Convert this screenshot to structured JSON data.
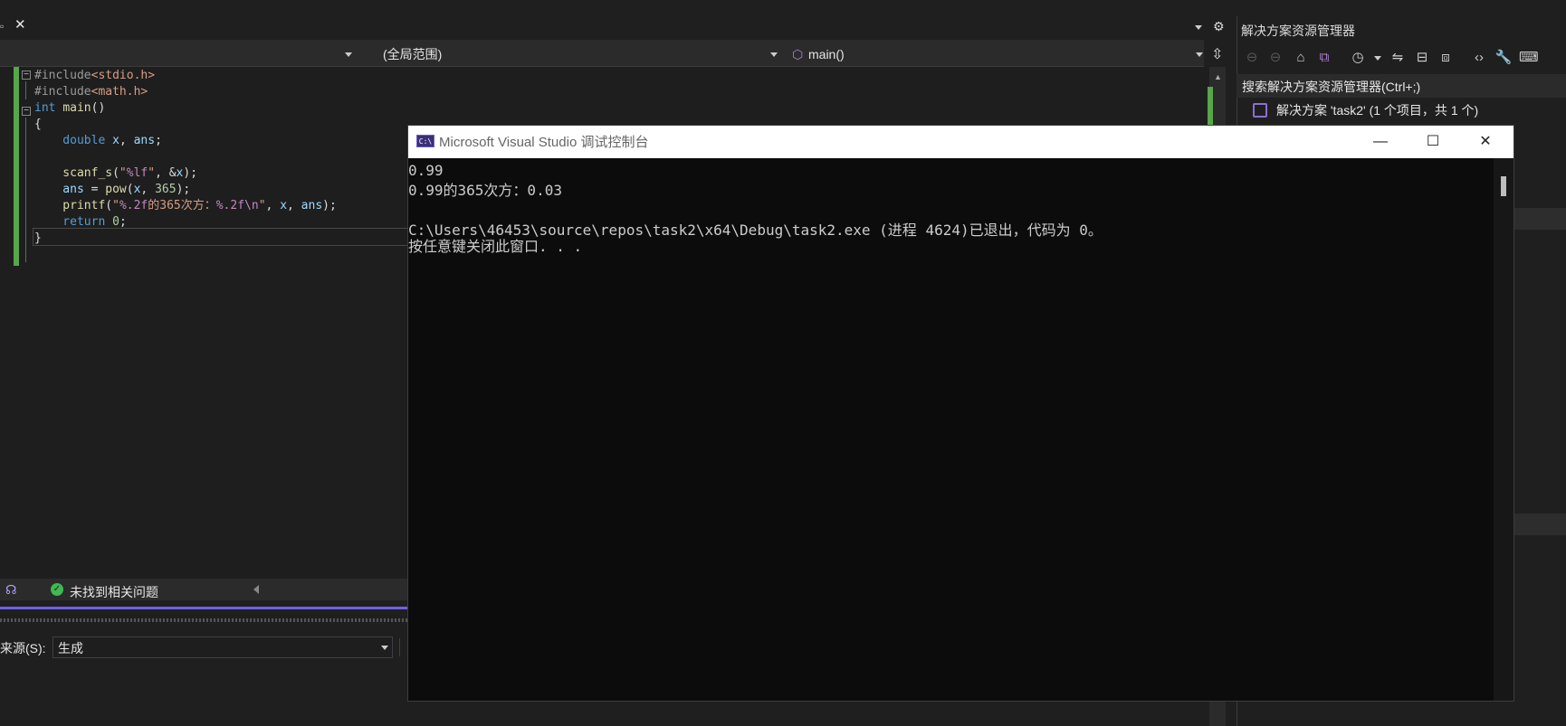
{
  "editor": {
    "scope_combo": "(全局范围)",
    "member_combo": "main()",
    "code": [
      [
        {
          "c": "pp",
          "t": "#include"
        },
        {
          "c": "inc",
          "t": "<stdio.h>"
        }
      ],
      [
        {
          "c": "pp",
          "t": "#include"
        },
        {
          "c": "inc",
          "t": "<math.h>"
        }
      ],
      [
        {
          "c": "kw",
          "t": "int"
        },
        {
          "c": "plain",
          "t": " "
        },
        {
          "c": "fn",
          "t": "main"
        },
        {
          "c": "plain",
          "t": "()"
        }
      ],
      [
        {
          "c": "plain",
          "t": "{"
        }
      ],
      [
        {
          "c": "kw",
          "t": "    double"
        },
        {
          "c": "plain",
          "t": " "
        },
        {
          "c": "var",
          "t": "x"
        },
        {
          "c": "plain",
          "t": ", "
        },
        {
          "c": "var",
          "t": "ans"
        },
        {
          "c": "plain",
          "t": ";"
        }
      ],
      [
        {
          "c": "plain",
          "t": ""
        }
      ],
      [
        {
          "c": "fn",
          "t": "    scanf_s"
        },
        {
          "c": "plain",
          "t": "("
        },
        {
          "c": "str",
          "t": "\""
        },
        {
          "c": "fmt",
          "t": "%lf"
        },
        {
          "c": "str",
          "t": "\""
        },
        {
          "c": "plain",
          "t": ", &"
        },
        {
          "c": "var",
          "t": "x"
        },
        {
          "c": "plain",
          "t": ");"
        }
      ],
      [
        {
          "c": "var",
          "t": "    ans"
        },
        {
          "c": "plain",
          "t": " = "
        },
        {
          "c": "fn",
          "t": "pow"
        },
        {
          "c": "plain",
          "t": "("
        },
        {
          "c": "var",
          "t": "x"
        },
        {
          "c": "plain",
          "t": ", "
        },
        {
          "c": "num",
          "t": "365"
        },
        {
          "c": "plain",
          "t": ");"
        }
      ],
      [
        {
          "c": "fn",
          "t": "    printf"
        },
        {
          "c": "plain",
          "t": "("
        },
        {
          "c": "str",
          "t": "\""
        },
        {
          "c": "fmt",
          "t": "%.2f"
        },
        {
          "c": "str",
          "t": "的365次方："
        },
        {
          "c": "fmt",
          "t": "%.2f"
        },
        {
          "c": "fmt",
          "t": "\\n"
        },
        {
          "c": "str",
          "t": "\""
        },
        {
          "c": "plain",
          "t": ", "
        },
        {
          "c": "var",
          "t": "x"
        },
        {
          "c": "plain",
          "t": ", "
        },
        {
          "c": "var",
          "t": "ans"
        },
        {
          "c": "plain",
          "t": ");"
        }
      ],
      [
        {
          "c": "kw",
          "t": "    return"
        },
        {
          "c": "plain",
          "t": " "
        },
        {
          "c": "num",
          "t": "0"
        },
        {
          "c": "plain",
          "t": ";"
        }
      ],
      [
        {
          "c": "plain",
          "t": "}"
        }
      ]
    ]
  },
  "status": {
    "issues_text": "未找到相关问题"
  },
  "output": {
    "source_label": "来源(S):",
    "source_value": "生成"
  },
  "solution_explorer": {
    "title": "解决方案资源管理器",
    "search_placeholder": "搜索解决方案资源管理器(Ctrl+;)",
    "solution_item": "解决方案 'task2' (1 个项目，共 1 个)"
  },
  "console": {
    "title": "Microsoft Visual Studio 调试控制台",
    "icon_text": "C:\\",
    "lines": [
      "0.99",
      "0.99的365次方：0.03",
      "",
      "C:\\Users\\46453\\source\\repos\\task2\\x64\\Debug\\task2.exe (进程 4624)已退出，代码为 0。",
      "按任意键关闭此窗口. . ."
    ],
    "minimize": "—",
    "maximize": "☐",
    "close": "✕"
  },
  "colors": {
    "accent_purple": "#7160e8",
    "change_green": "#57a64a"
  }
}
